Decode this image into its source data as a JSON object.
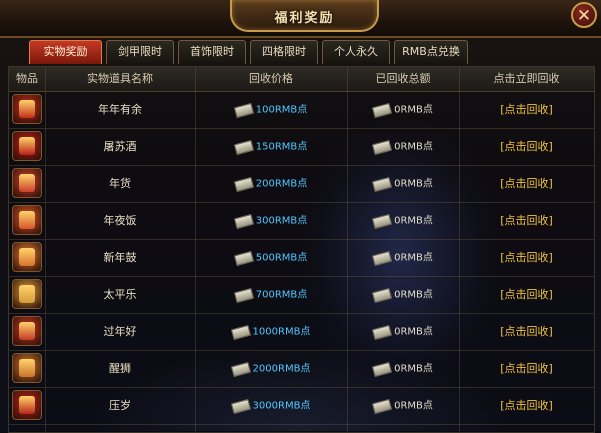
{
  "window": {
    "title": "福利奖励",
    "close_glyph": "✕"
  },
  "tabs": [
    "实物奖励",
    "剑甲限时",
    "首饰限时",
    "四格限时",
    "个人永久",
    "RMB点兑换"
  ],
  "table": {
    "headers": [
      "物品",
      "实物道具名称",
      "回收价格",
      "已回收总额",
      "点击立即回收"
    ],
    "rows": [
      {
        "name": "年年有余",
        "price": "100RMB点",
        "collected": "0RMB点",
        "action": "[点击回收]",
        "icon": "red-lantern-icon",
        "color": "#c0301a"
      },
      {
        "name": "屠苏酒",
        "price": "150RMB点",
        "collected": "0RMB点",
        "action": "[点击回收]",
        "icon": "wine-jar-icon",
        "color": "#b82218"
      },
      {
        "name": "年货",
        "price": "200RMB点",
        "collected": "0RMB点",
        "action": "[点击回收]",
        "icon": "gift-box-icon",
        "color": "#c8402a"
      },
      {
        "name": "年夜饭",
        "price": "300RMB点",
        "collected": "0RMB点",
        "action": "[点击回收]",
        "icon": "feast-icon",
        "color": "#d5562a"
      },
      {
        "name": "新年鼓",
        "price": "500RMB点",
        "collected": "0RMB点",
        "action": "[点击回收]",
        "icon": "drum-icon",
        "color": "#d8742e"
      },
      {
        "name": "太平乐",
        "price": "700RMB点",
        "collected": "0RMB点",
        "action": "[点击回收]",
        "icon": "lion-face-icon",
        "color": "#d69a3a"
      },
      {
        "name": "过年好",
        "price": "1000RMB点",
        "collected": "0RMB点",
        "action": "[点击回收]",
        "icon": "firecracker-icon",
        "color": "#c23a22"
      },
      {
        "name": "醒狮",
        "price": "2000RMB点",
        "collected": "0RMB点",
        "action": "[点击回收]",
        "icon": "awakening-lion-icon",
        "color": "#c8762a"
      },
      {
        "name": "压岁",
        "price": "3000RMB点",
        "collected": "0RMB点",
        "action": "[点击回收]",
        "icon": "red-envelope-icon",
        "color": "#b8261a"
      }
    ]
  }
}
